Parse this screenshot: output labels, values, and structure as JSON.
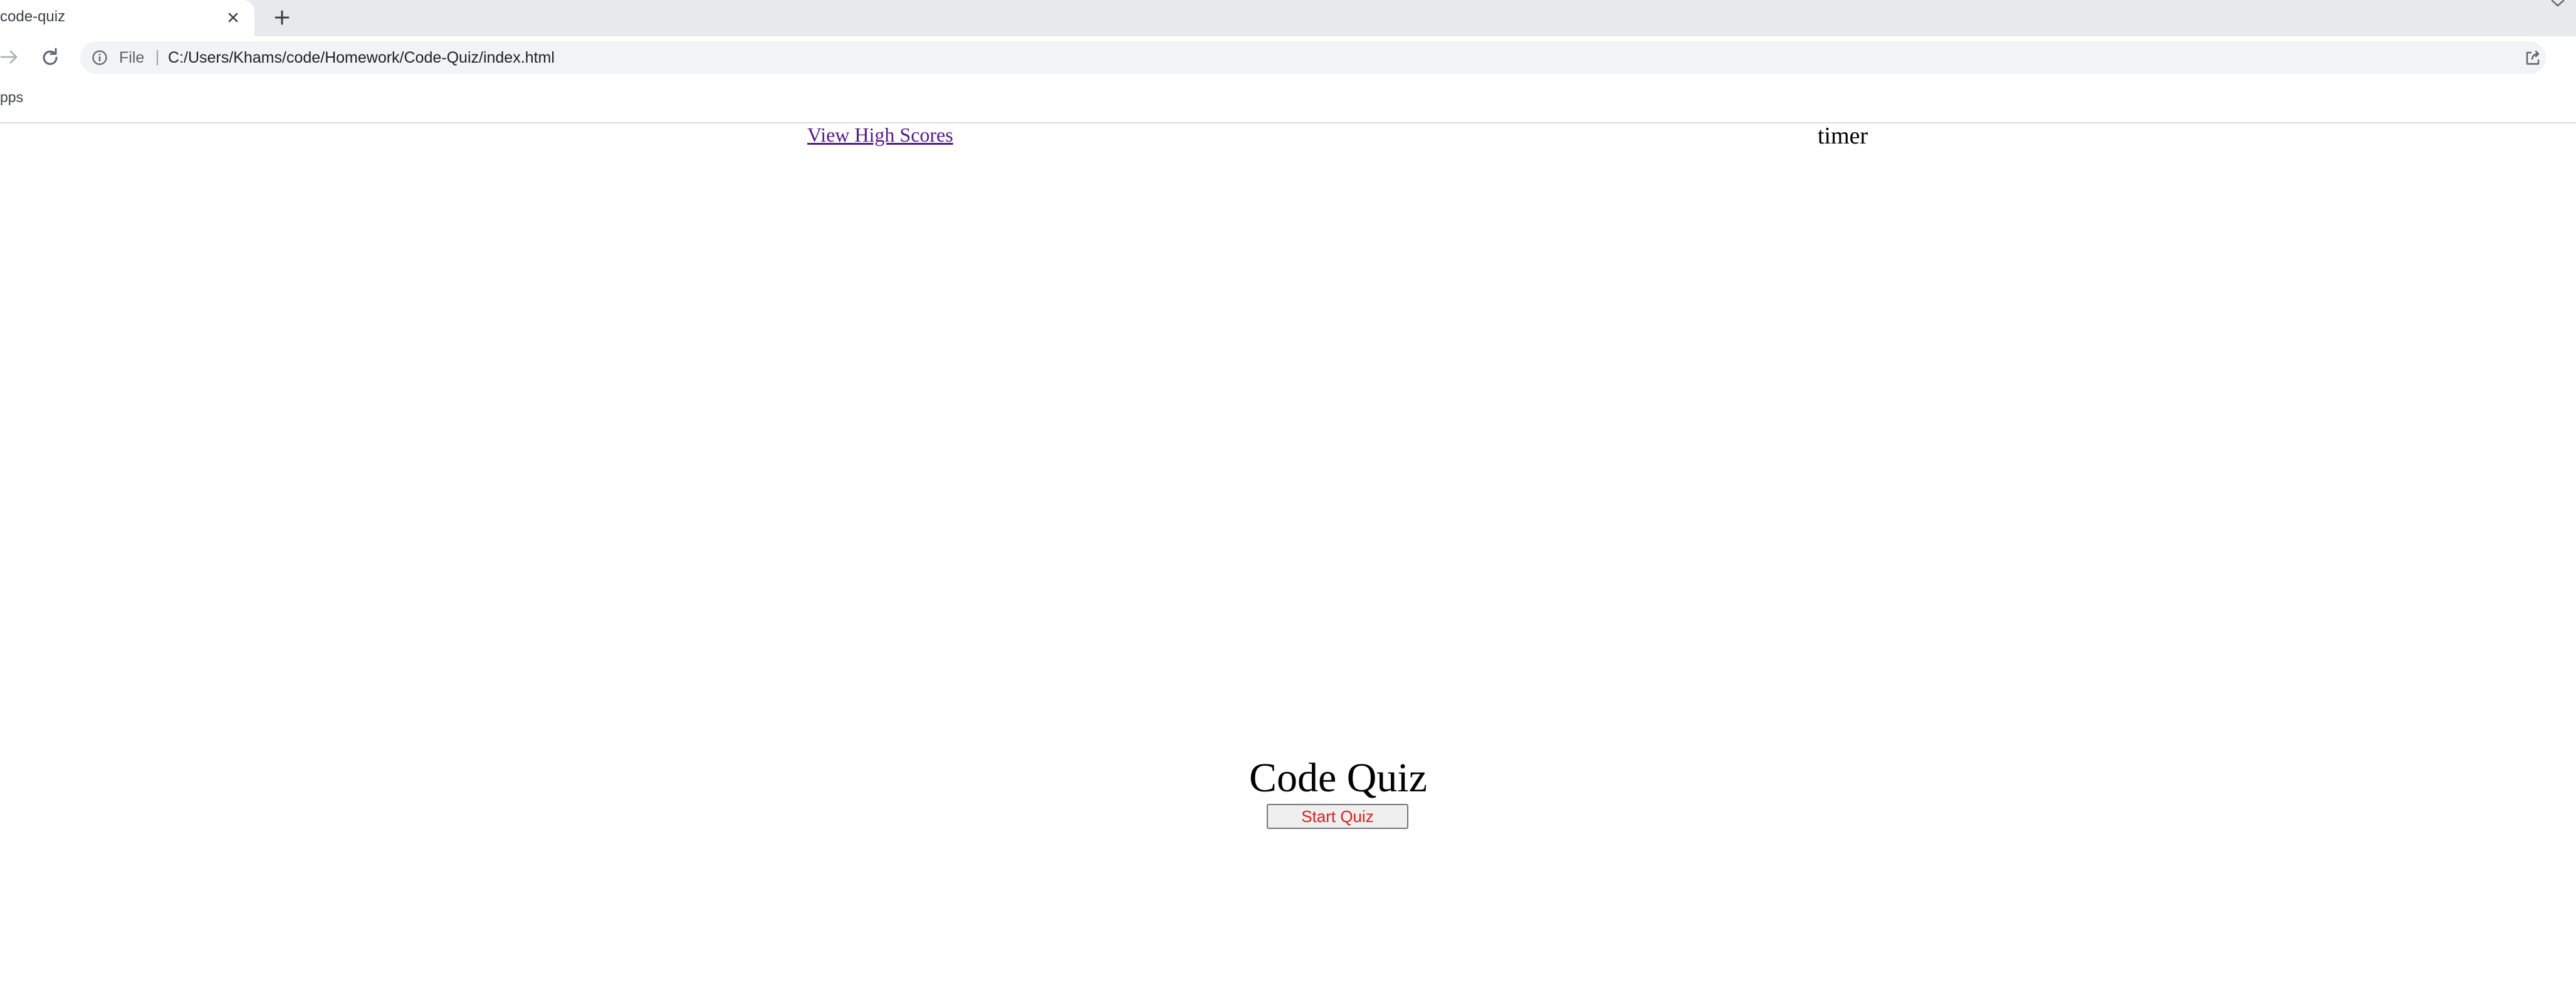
{
  "browser": {
    "tab": {
      "title": "code-quiz",
      "visible_title": "code-quiz"
    },
    "address_bar": {
      "scheme_label": "File",
      "url": "C:/Users/Khams/code/Homework/Code-Quiz/index.html"
    },
    "bookmarks": {
      "apps_label": "pps"
    }
  },
  "page": {
    "high_scores_link": "View High Scores",
    "timer_label": "timer",
    "title": "Code Quiz",
    "start_button": "Start Quiz"
  },
  "colors": {
    "link": "#551a8b",
    "start_button_text": "#e0201c",
    "tabstrip_bg": "#e8e9ec",
    "omnibox_bg": "#f1f3f4"
  }
}
